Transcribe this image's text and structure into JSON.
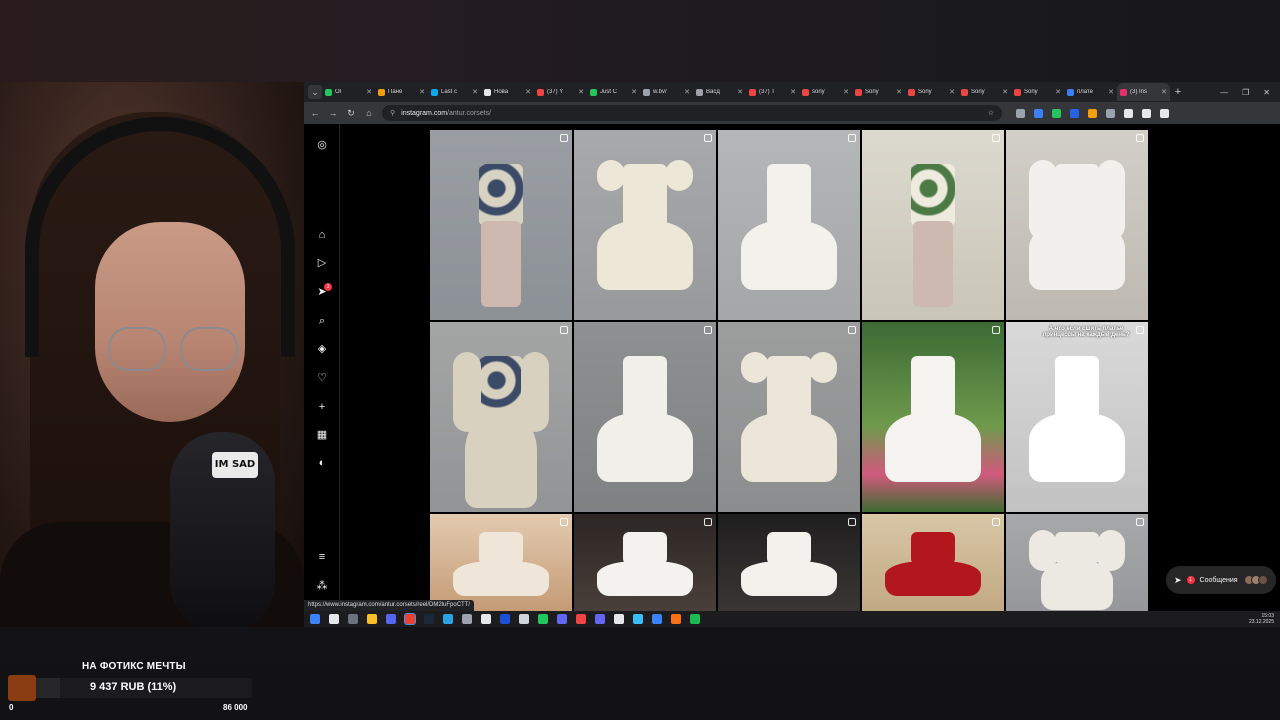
{
  "browser": {
    "tabs": [
      {
        "label": "OI",
        "color": "#22c55e"
      },
      {
        "label": "Пане",
        "color": "#f59e0b"
      },
      {
        "label": "Last c",
        "color": "#0ea5e9"
      },
      {
        "label": "Нова",
        "color": "#e5e7eb"
      },
      {
        "label": "(37) Y",
        "color": "#ef4444"
      },
      {
        "label": "Just C",
        "color": "#22c55e"
      },
      {
        "label": "w.bv/",
        "color": "#9ca3af"
      },
      {
        "label": "Васд",
        "color": "#9ca3af"
      },
      {
        "label": "(37) T",
        "color": "#ef4444"
      },
      {
        "label": "sony",
        "color": "#ef4444"
      },
      {
        "label": "Sony",
        "color": "#ef4444"
      },
      {
        "label": "Sony",
        "color": "#ef4444"
      },
      {
        "label": "Sony",
        "color": "#ef4444"
      },
      {
        "label": "Sony",
        "color": "#ef4444"
      },
      {
        "label": "плате",
        "color": "#3b82f6"
      },
      {
        "label": "(3) Ins",
        "color": "#e1306c",
        "active": true
      }
    ],
    "address": {
      "host": "instagram.com",
      "path": "/antur.corsets/"
    },
    "status_url": "https://www.instagram.com/antur.corsets/reel/DM2luFpoCTT/"
  },
  "instagram": {
    "notification_count": "3",
    "messages_label": "Сообщения",
    "messages_badge": "1"
  },
  "taskbar": {
    "time": "15:03",
    "date": "23.12.2025"
  },
  "webcam": {
    "mic_badge": "IM SAD"
  },
  "donation": {
    "title": "НА ФОТИКС МЕЧТЫ",
    "amount": "9 437 RUB (11%)",
    "progress": 0.11,
    "min": "0",
    "max": "86 000"
  },
  "posts": [
    {
      "caption": ""
    },
    {
      "caption": ""
    },
    {
      "caption": ""
    },
    {
      "caption": ""
    },
    {
      "caption": ""
    },
    {
      "caption": ""
    },
    {
      "caption": ""
    },
    {
      "caption": ""
    },
    {
      "caption": ""
    },
    {
      "caption": "А что если сшить платье принцессы на каждый день?"
    },
    {
      "caption": ""
    },
    {
      "caption": ""
    },
    {
      "caption": ""
    },
    {
      "caption": ""
    },
    {
      "caption": ""
    }
  ]
}
